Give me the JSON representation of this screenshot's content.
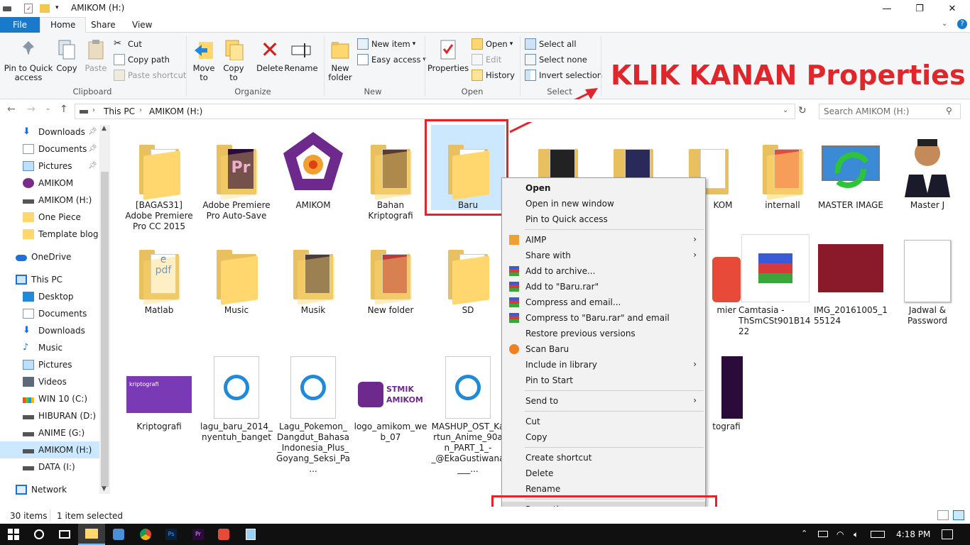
{
  "window": {
    "title": "AMIKOM (H:)",
    "controls": {
      "minimize": "—",
      "maximize": "❐",
      "close": "✕"
    }
  },
  "ribbon_tabs": [
    "File",
    "Home",
    "Share",
    "View"
  ],
  "ribbon": {
    "clipboard": {
      "label": "Clipboard",
      "pin": "Pin to Quick access",
      "copy": "Copy",
      "paste": "Paste",
      "cut": "Cut",
      "copy_path": "Copy path",
      "paste_shortcut": "Paste shortcut"
    },
    "organize": {
      "label": "Organize",
      "move_to": "Move to",
      "copy_to": "Copy to",
      "delete": "Delete",
      "rename": "Rename"
    },
    "new": {
      "label": "New",
      "new_folder": "New folder",
      "new_item": "New item",
      "easy_access": "Easy access"
    },
    "open": {
      "label": "Open",
      "properties": "Properties",
      "open": "Open",
      "edit": "Edit",
      "history": "History"
    },
    "select": {
      "label": "Select",
      "select_all": "Select all",
      "select_none": "Select none",
      "invert": "Invert selection"
    }
  },
  "annotation": {
    "text": "KLIK KANAN Properties",
    "color": "#e0262b"
  },
  "address": {
    "path": [
      "This PC",
      "AMIKOM (H:)"
    ],
    "search_placeholder": "Search AMIKOM (H:)"
  },
  "nav": {
    "quick": [
      "Downloads",
      "Documents",
      "Pictures",
      "AMIKOM",
      "AMIKOM (H:)",
      "One Piece",
      "Template blog R"
    ],
    "onedrive": "OneDrive",
    "thispc": "This PC",
    "pc_items": [
      "Desktop",
      "Documents",
      "Downloads",
      "Music",
      "Pictures",
      "Videos",
      "WIN 10 (C:)",
      "HIBURAN (D:)",
      "ANIME (G:)",
      "AMIKOM (H:)",
      "DATA (I:)"
    ],
    "network": "Network"
  },
  "files_row1": [
    "[BAGAS31] Adobe Premiere Pro CC 2015",
    "Adobe Premiere Pro Auto-Save",
    "AMIKOM",
    "Bahan Kriptografi",
    "Baru",
    "",
    "",
    "KOM",
    "internall",
    "MASTER IMAGE",
    "Master J"
  ],
  "files_row2": [
    "Matlab",
    "Music",
    "Musik",
    "New folder",
    "SD",
    "",
    "",
    "mier",
    "Camtasia - ThSmCSt901B1422",
    "IMG_20161005_155124",
    "Jadwal & Password"
  ],
  "files_row3": [
    "Kriptografi",
    "lagu_baru_2014_nyentuh_banget",
    "Lagu_Pokemon_Dangdut_Bahasa_Indonesia_Plus_Goyang_Seksi_Pa...",
    "logo_amikom_web_07",
    "MASHUP_OST_Kartun_Anime_90an_PART_1_-_@EkaGustiwana___...",
    "",
    "",
    "tografi"
  ],
  "context_menu": {
    "open": "Open",
    "open_new": "Open in new window",
    "pin_quick": "Pin to Quick access",
    "aimp": "AIMP",
    "share_with": "Share with",
    "add_archive": "Add to archive...",
    "add_rar": "Add to \"Baru.rar\"",
    "compress_email": "Compress and email...",
    "compress_rar_email": "Compress to \"Baru.rar\" and email",
    "restore": "Restore previous versions",
    "scan": "Scan Baru",
    "include_library": "Include in library",
    "pin_start": "Pin to Start",
    "send_to": "Send to",
    "cut": "Cut",
    "copy": "Copy",
    "create_shortcut": "Create shortcut",
    "delete": "Delete",
    "rename": "Rename",
    "properties": "Properties"
  },
  "status": {
    "items": "30 items",
    "selected": "1 item selected"
  },
  "taskbar": {
    "time": "4:18 PM"
  },
  "colors": {
    "accent": "#1979ca",
    "highlight": "#cce8ff",
    "taskbar": "#101010"
  }
}
